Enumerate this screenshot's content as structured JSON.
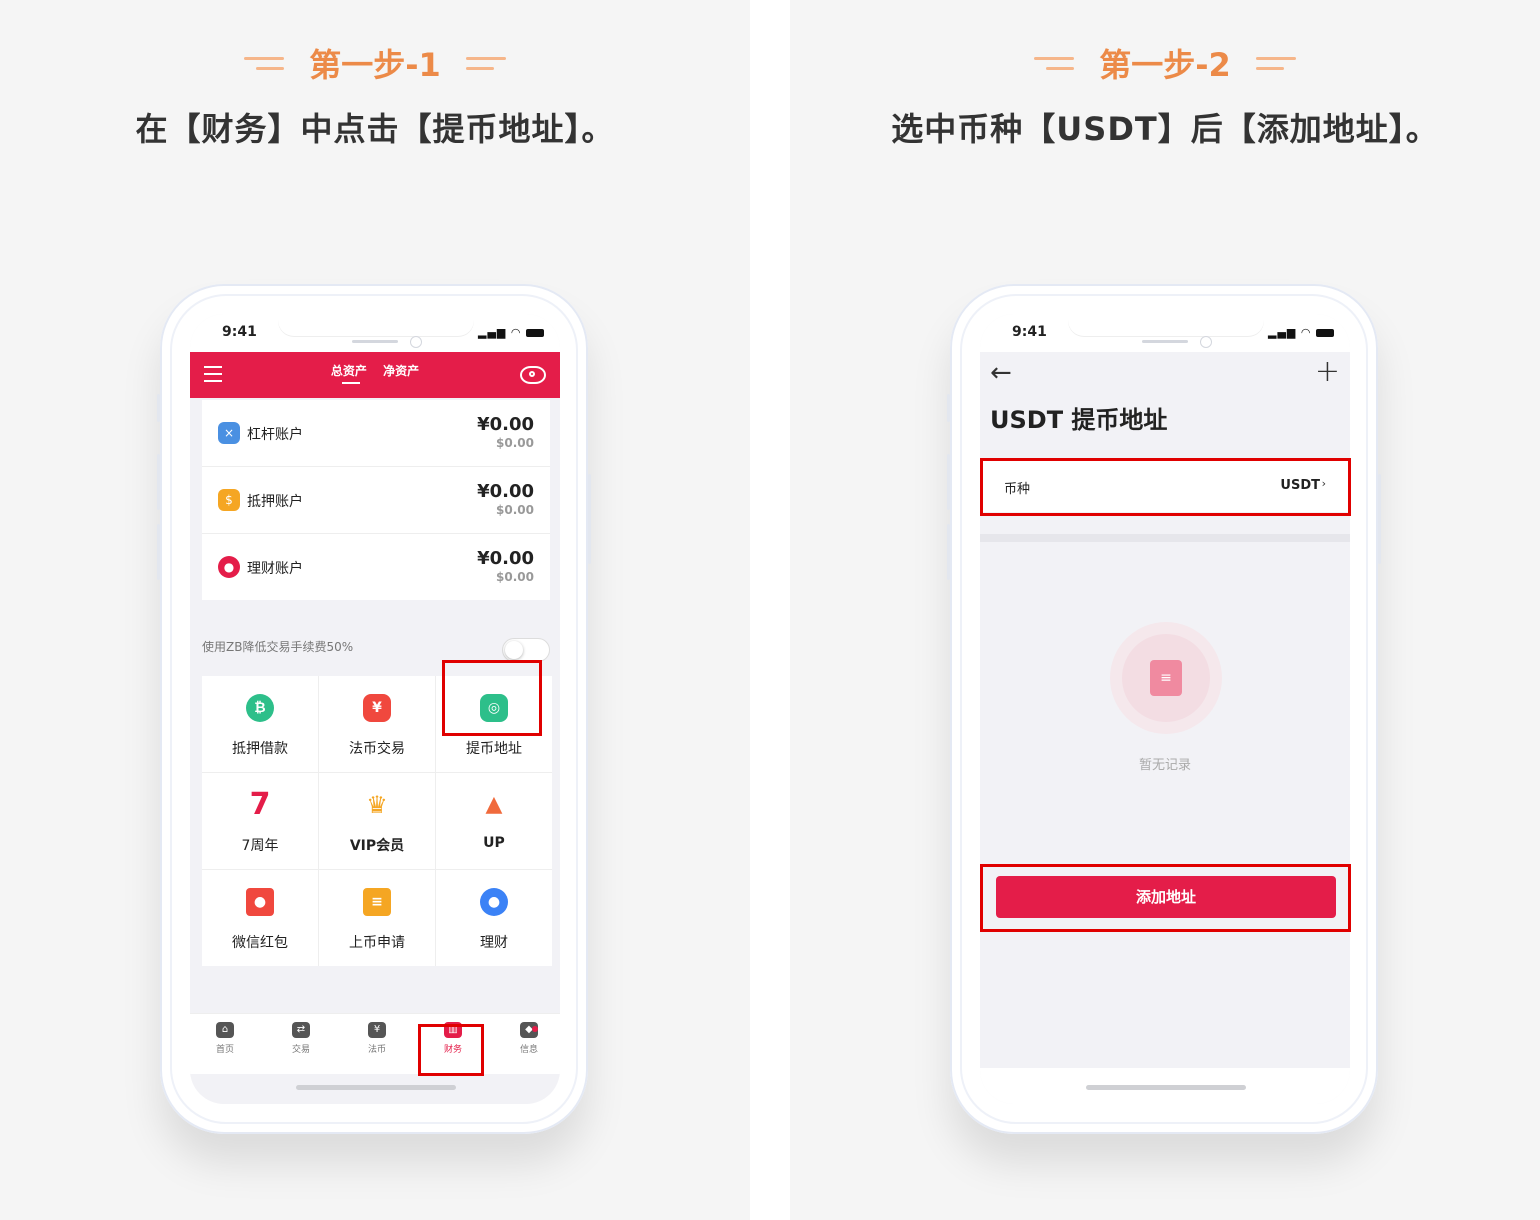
{
  "step1": {
    "title": "第一步-1",
    "desc": "在【财务】中点击【提币地址】。",
    "phone": {
      "time": "9:41",
      "tabs": [
        "总资产",
        "净资产"
      ],
      "accounts": [
        {
          "name": "杠杆账户",
          "cny": "¥0.00",
          "usd": "$0.00",
          "icon": "leverage-icon",
          "color": "#4a90e2"
        },
        {
          "name": "抵押账户",
          "cny": "¥0.00",
          "usd": "$0.00",
          "icon": "collateral-icon",
          "color": "#f5a623"
        },
        {
          "name": "理财账户",
          "cny": "¥0.00",
          "usd": "$0.00",
          "icon": "piggy-bank-icon",
          "color": "#e41d49"
        }
      ],
      "zb_fee_text": "使用ZB降低交易手续费50%",
      "grid": [
        {
          "label": "抵押借款",
          "icon": "loan-icon",
          "glyph": "₿",
          "color": "#2dbf8a"
        },
        {
          "label": "法币交易",
          "icon": "fiat-trade-icon",
          "glyph": "¥",
          "color": "#f0483e"
        },
        {
          "label": "提币地址",
          "icon": "withdraw-address-icon",
          "glyph": "◎",
          "color": "#2dbf8a"
        },
        {
          "label": "7周年",
          "icon": "anniversary-icon",
          "glyph": "7",
          "color": "#e41d49"
        },
        {
          "label": "VIP会员",
          "icon": "vip-crown-icon",
          "glyph": "♛",
          "color": "#f5a623"
        },
        {
          "label": "UP",
          "icon": "rocket-icon",
          "glyph": "▲",
          "color": "#f06a3c"
        },
        {
          "label": "微信红包",
          "icon": "red-packet-icon",
          "glyph": "●",
          "color": "#f0483e"
        },
        {
          "label": "上币申请",
          "icon": "listing-apply-icon",
          "glyph": "≡",
          "color": "#f5a623"
        },
        {
          "label": "理财",
          "icon": "wealth-icon",
          "glyph": "●",
          "color": "#3b82f6"
        }
      ],
      "tabbar": [
        {
          "label": "首页",
          "icon": "home-icon",
          "glyph": "⌂"
        },
        {
          "label": "交易",
          "icon": "trade-icon",
          "glyph": "⇄"
        },
        {
          "label": "法币",
          "icon": "fiat-icon",
          "glyph": "¥"
        },
        {
          "label": "财务",
          "icon": "finance-icon",
          "glyph": "▥",
          "active": true
        },
        {
          "label": "信息",
          "icon": "info-icon",
          "glyph": "◆"
        }
      ]
    }
  },
  "step2": {
    "title": "第一步-2",
    "desc": "选中币种【USDT】后【添加地址】。",
    "phone": {
      "time": "9:41",
      "page_title": "USDT 提币地址",
      "coin_label": "币种",
      "coin_value": "USDT",
      "empty_text": "暂无记录",
      "add_button": "添加地址"
    }
  },
  "colors": {
    "brand_red": "#e41d49",
    "step_orange": "#ec8a48",
    "highlight": "#e00000"
  }
}
